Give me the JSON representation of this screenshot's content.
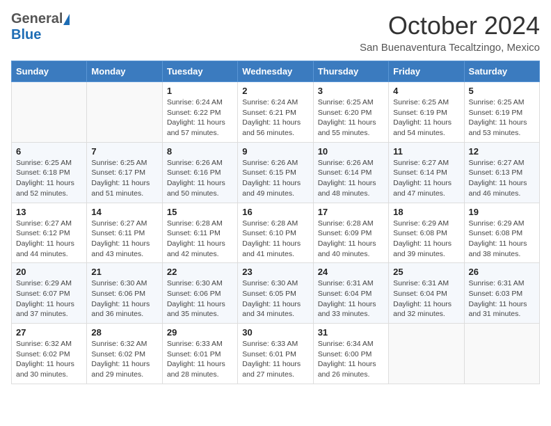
{
  "header": {
    "logo_general": "General",
    "logo_blue": "Blue",
    "month_title": "October 2024",
    "location": "San Buenaventura Tecaltzingo, Mexico"
  },
  "days_of_week": [
    "Sunday",
    "Monday",
    "Tuesday",
    "Wednesday",
    "Thursday",
    "Friday",
    "Saturday"
  ],
  "weeks": [
    [
      {
        "day": "",
        "content": ""
      },
      {
        "day": "",
        "content": ""
      },
      {
        "day": "1",
        "content": "Sunrise: 6:24 AM\nSunset: 6:22 PM\nDaylight: 11 hours and 57 minutes."
      },
      {
        "day": "2",
        "content": "Sunrise: 6:24 AM\nSunset: 6:21 PM\nDaylight: 11 hours and 56 minutes."
      },
      {
        "day": "3",
        "content": "Sunrise: 6:25 AM\nSunset: 6:20 PM\nDaylight: 11 hours and 55 minutes."
      },
      {
        "day": "4",
        "content": "Sunrise: 6:25 AM\nSunset: 6:19 PM\nDaylight: 11 hours and 54 minutes."
      },
      {
        "day": "5",
        "content": "Sunrise: 6:25 AM\nSunset: 6:19 PM\nDaylight: 11 hours and 53 minutes."
      }
    ],
    [
      {
        "day": "6",
        "content": "Sunrise: 6:25 AM\nSunset: 6:18 PM\nDaylight: 11 hours and 52 minutes."
      },
      {
        "day": "7",
        "content": "Sunrise: 6:25 AM\nSunset: 6:17 PM\nDaylight: 11 hours and 51 minutes."
      },
      {
        "day": "8",
        "content": "Sunrise: 6:26 AM\nSunset: 6:16 PM\nDaylight: 11 hours and 50 minutes."
      },
      {
        "day": "9",
        "content": "Sunrise: 6:26 AM\nSunset: 6:15 PM\nDaylight: 11 hours and 49 minutes."
      },
      {
        "day": "10",
        "content": "Sunrise: 6:26 AM\nSunset: 6:14 PM\nDaylight: 11 hours and 48 minutes."
      },
      {
        "day": "11",
        "content": "Sunrise: 6:27 AM\nSunset: 6:14 PM\nDaylight: 11 hours and 47 minutes."
      },
      {
        "day": "12",
        "content": "Sunrise: 6:27 AM\nSunset: 6:13 PM\nDaylight: 11 hours and 46 minutes."
      }
    ],
    [
      {
        "day": "13",
        "content": "Sunrise: 6:27 AM\nSunset: 6:12 PM\nDaylight: 11 hours and 44 minutes."
      },
      {
        "day": "14",
        "content": "Sunrise: 6:27 AM\nSunset: 6:11 PM\nDaylight: 11 hours and 43 minutes."
      },
      {
        "day": "15",
        "content": "Sunrise: 6:28 AM\nSunset: 6:11 PM\nDaylight: 11 hours and 42 minutes."
      },
      {
        "day": "16",
        "content": "Sunrise: 6:28 AM\nSunset: 6:10 PM\nDaylight: 11 hours and 41 minutes."
      },
      {
        "day": "17",
        "content": "Sunrise: 6:28 AM\nSunset: 6:09 PM\nDaylight: 11 hours and 40 minutes."
      },
      {
        "day": "18",
        "content": "Sunrise: 6:29 AM\nSunset: 6:08 PM\nDaylight: 11 hours and 39 minutes."
      },
      {
        "day": "19",
        "content": "Sunrise: 6:29 AM\nSunset: 6:08 PM\nDaylight: 11 hours and 38 minutes."
      }
    ],
    [
      {
        "day": "20",
        "content": "Sunrise: 6:29 AM\nSunset: 6:07 PM\nDaylight: 11 hours and 37 minutes."
      },
      {
        "day": "21",
        "content": "Sunrise: 6:30 AM\nSunset: 6:06 PM\nDaylight: 11 hours and 36 minutes."
      },
      {
        "day": "22",
        "content": "Sunrise: 6:30 AM\nSunset: 6:06 PM\nDaylight: 11 hours and 35 minutes."
      },
      {
        "day": "23",
        "content": "Sunrise: 6:30 AM\nSunset: 6:05 PM\nDaylight: 11 hours and 34 minutes."
      },
      {
        "day": "24",
        "content": "Sunrise: 6:31 AM\nSunset: 6:04 PM\nDaylight: 11 hours and 33 minutes."
      },
      {
        "day": "25",
        "content": "Sunrise: 6:31 AM\nSunset: 6:04 PM\nDaylight: 11 hours and 32 minutes."
      },
      {
        "day": "26",
        "content": "Sunrise: 6:31 AM\nSunset: 6:03 PM\nDaylight: 11 hours and 31 minutes."
      }
    ],
    [
      {
        "day": "27",
        "content": "Sunrise: 6:32 AM\nSunset: 6:02 PM\nDaylight: 11 hours and 30 minutes."
      },
      {
        "day": "28",
        "content": "Sunrise: 6:32 AM\nSunset: 6:02 PM\nDaylight: 11 hours and 29 minutes."
      },
      {
        "day": "29",
        "content": "Sunrise: 6:33 AM\nSunset: 6:01 PM\nDaylight: 11 hours and 28 minutes."
      },
      {
        "day": "30",
        "content": "Sunrise: 6:33 AM\nSunset: 6:01 PM\nDaylight: 11 hours and 27 minutes."
      },
      {
        "day": "31",
        "content": "Sunrise: 6:34 AM\nSunset: 6:00 PM\nDaylight: 11 hours and 26 minutes."
      },
      {
        "day": "",
        "content": ""
      },
      {
        "day": "",
        "content": ""
      }
    ]
  ]
}
